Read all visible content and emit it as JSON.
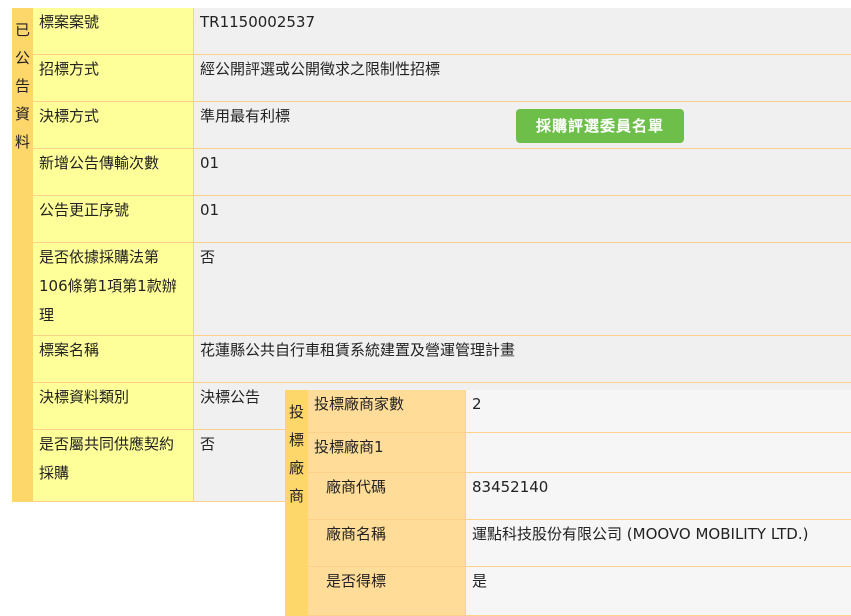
{
  "panel_a": {
    "side_label": [
      "已",
      "公",
      "告",
      "資",
      "料"
    ],
    "rows": [
      {
        "label": "標案案號",
        "value": "TR1150002537"
      },
      {
        "label": "招標方式",
        "value": "經公開評選或公開徵求之限制性招標"
      },
      {
        "label": "決標方式",
        "value": "準用最有利標"
      },
      {
        "label": "新增公告傳輸次數",
        "value": "01"
      },
      {
        "label": "公告更正序號",
        "value": "01"
      },
      {
        "label": "是否依據採購法第106條第1項第1款辦理",
        "value": "否"
      },
      {
        "label": "標案名稱",
        "value": "花蓮縣公共自行車租賃系統建置及營運管理計畫"
      },
      {
        "label": "決標資料類別",
        "value": "決標公告"
      },
      {
        "label": "是否屬共同供應契約採購",
        "value": "否"
      }
    ],
    "committee_button": "採購評選委員名單"
  },
  "panel_b": {
    "side_label": [
      "投",
      "標",
      "廠",
      "商"
    ],
    "rows": [
      {
        "label": "投標廠商家數",
        "value": "2"
      },
      {
        "label": "投標廠商1",
        "value": ""
      },
      {
        "label": "廠商代碼",
        "value": "83452140"
      },
      {
        "label": "廠商名稱",
        "value": "運點科技股份有限公司 (MOOVO MOBILITY LTD.)"
      },
      {
        "label": "是否得標",
        "value": "是"
      }
    ]
  }
}
